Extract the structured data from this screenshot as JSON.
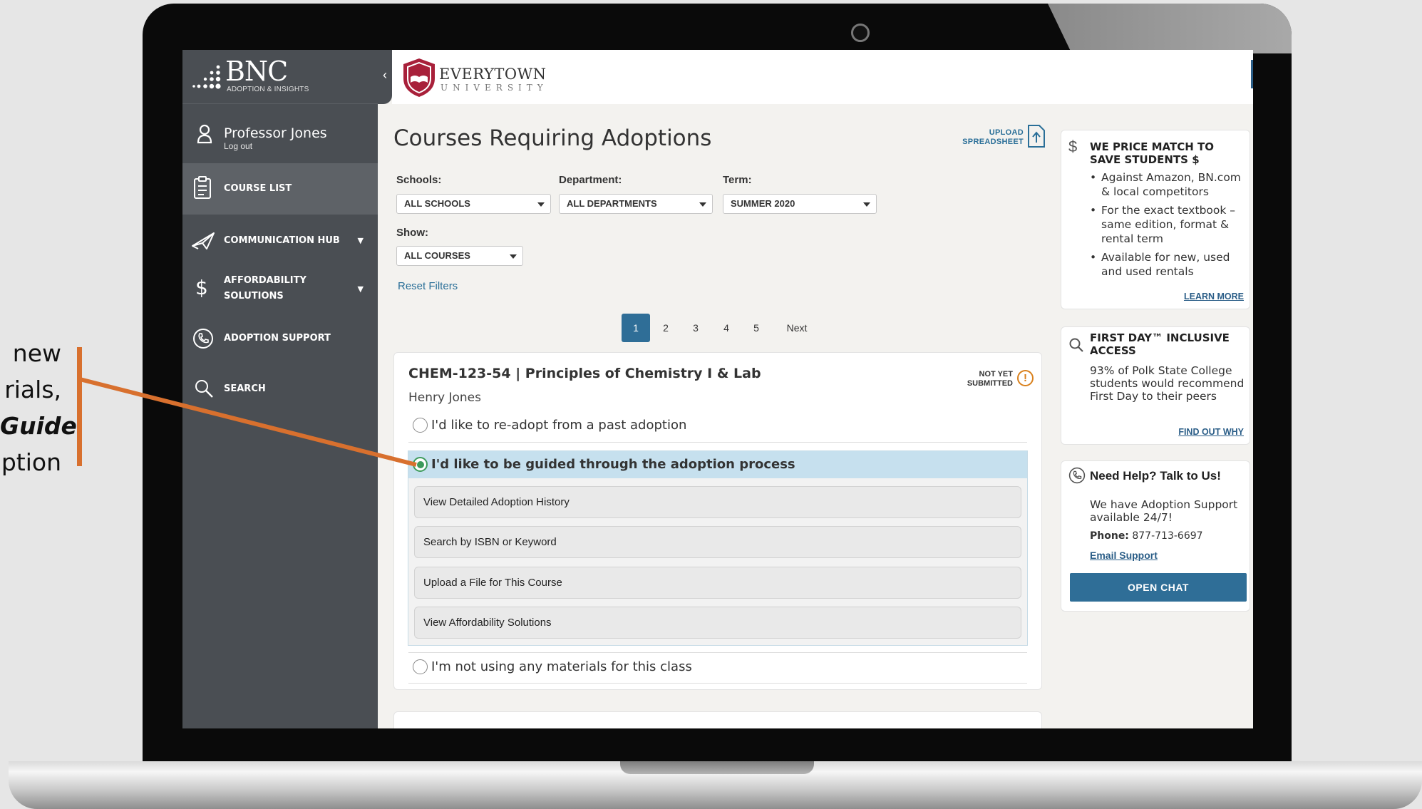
{
  "callout": {
    "lines": [
      "new",
      "rials,",
      "Guide",
      "ption"
    ],
    "accent_color": "#d8702e"
  },
  "brand": {
    "name": "BNC",
    "subtitle": "ADOPTION & INSIGHTS"
  },
  "university": {
    "name": "EVERYTOWN",
    "subtitle": "UNIVERSITY",
    "crest_color": "#a8203a"
  },
  "user": {
    "name": "Professor Jones",
    "logout_label": "Log out"
  },
  "sidebar": {
    "items": [
      {
        "label": "COURSE LIST",
        "icon": "clipboard-icon",
        "active": true
      },
      {
        "label": "COMMUNICATION HUB",
        "icon": "paper-plane-icon",
        "has_caret": true
      },
      {
        "label": "AFFORDABILITY",
        "label2": "SOLUTIONS",
        "icon": "dollar-icon",
        "has_caret": true
      },
      {
        "label": "ADOPTION SUPPORT",
        "icon": "phone-icon"
      },
      {
        "label": "SEARCH",
        "icon": "search-icon"
      }
    ]
  },
  "main": {
    "title": "Courses Requiring Adoptions",
    "upload_label_1": "UPLOAD",
    "upload_label_2": "SPREADSHEET",
    "filters": {
      "schools_label": "Schools:",
      "schools_value": "ALL SCHOOLS",
      "department_label": "Department:",
      "department_value": "ALL DEPARTMENTS",
      "term_label": "Term:",
      "term_value": "SUMMER 2020",
      "show_label": "Show:",
      "show_value": "ALL COURSES",
      "reset_label": "Reset Filters"
    },
    "pagination": {
      "pages": [
        "1",
        "2",
        "3",
        "4",
        "5"
      ],
      "current": "1",
      "next_label": "Next"
    },
    "course": {
      "title": "CHEM-123-54 | Principles of Chemistry I & Lab",
      "instructor": "Henry Jones",
      "status_1": "NOT YET",
      "status_2": "SUBMITTED",
      "status_icon": "!",
      "option_readopt": "I'd like to re-adopt from a past adoption",
      "option_guided": "I'd like to be guided through the adoption process",
      "sub_options": [
        "View Detailed Adoption History",
        "Search by ISBN or Keyword",
        "Upload a File for This Course",
        "View Affordability Solutions"
      ],
      "option_none": "I'm not using any materials for this class"
    }
  },
  "right": {
    "price_match": {
      "title": "WE PRICE MATCH TO SAVE STUDENTS $",
      "bullets": [
        "Against Amazon, BN.com & local competitors",
        "For the exact textbook – same edition, format & rental term",
        "Available for new, used and used rentals"
      ],
      "link": "LEARN MORE"
    },
    "first_day": {
      "title": "FIRST DAY™ INCLUSIVE ACCESS",
      "body": "93% of Polk State College students would recommend First Day to their peers",
      "link": "FIND OUT WHY"
    },
    "help": {
      "title": "Need Help? Talk to Us!",
      "body": "We have Adoption Support available 24/7!",
      "phone_label": "Phone:",
      "phone_value": "877-713-6697",
      "email_link": "Email Support",
      "chat_button": "OPEN CHAT"
    }
  }
}
